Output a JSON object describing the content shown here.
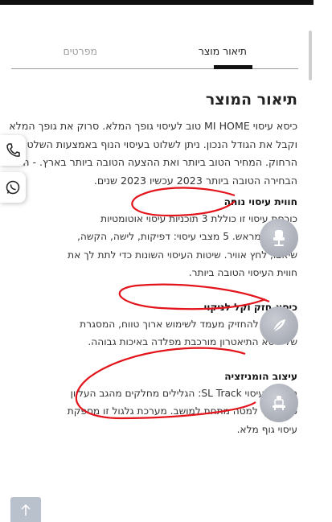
{
  "tabs": [
    {
      "label": "תיאור מוצר",
      "active": true
    },
    {
      "label": "מפרטים",
      "active": false
    }
  ],
  "section_title": "תיאור המוצר",
  "intro_text": "כיסא עיסוי MI HOME טוב לעיסוי גופך המלא. סרוק את גופך המלא וקבל את הגודל הנכון. ניתן לשלוט בעיסוי הנוף באמצעות השלט הרחוק. המחיר הטוב ביותר ואת ההצעה הטובה ביותר בארץ. - היה הבחירה הטובה ביותר 2023 עכשיו 2023 שנים.",
  "features": [
    {
      "title": "חווית עיסוי נוחה",
      "text": "כורסת עיסוי זו כוללת 3 תוכניות עיסוי אוטומטיות מוגדרות מראש. 5 מצבי עיסוי: דפיקות, לישה, הקשה, שיאצו, לחץ אוויר. שיטות העיסוי השונות כדי לתת לך את חווית העיסוי הטובה ביותר.",
      "icon": "chair-icon"
    },
    {
      "title": "כיסא חזק וקל לניקוי",
      "text": "נבנה כדי להחזיק מעמד לשימוש ארוך טווח, המסגרת של כיסא התיאטרון מורכבת מפלדה באיכות גבוהה.",
      "icon": "feather-icon"
    },
    {
      "title": "עיצוב הומניזציה",
      "text": "מערכת עיסוי SL Track: הגלילים מחלקים מהגב העליון כל הדרך למטה מתחת למושב. מערכת גלגול זו מספקת עיסוי גוף מלא.",
      "icon": "massage-track-icon"
    }
  ],
  "side_buttons": [
    {
      "icon": "phone-icon"
    },
    {
      "icon": "whatsapp-icon"
    }
  ],
  "back_to_top_icon": "arrow-up-icon",
  "colors": {
    "annotation_red": "#e3141b",
    "icon_circle": "#aeb2bb",
    "back_to_top": "#b9c2cc"
  }
}
